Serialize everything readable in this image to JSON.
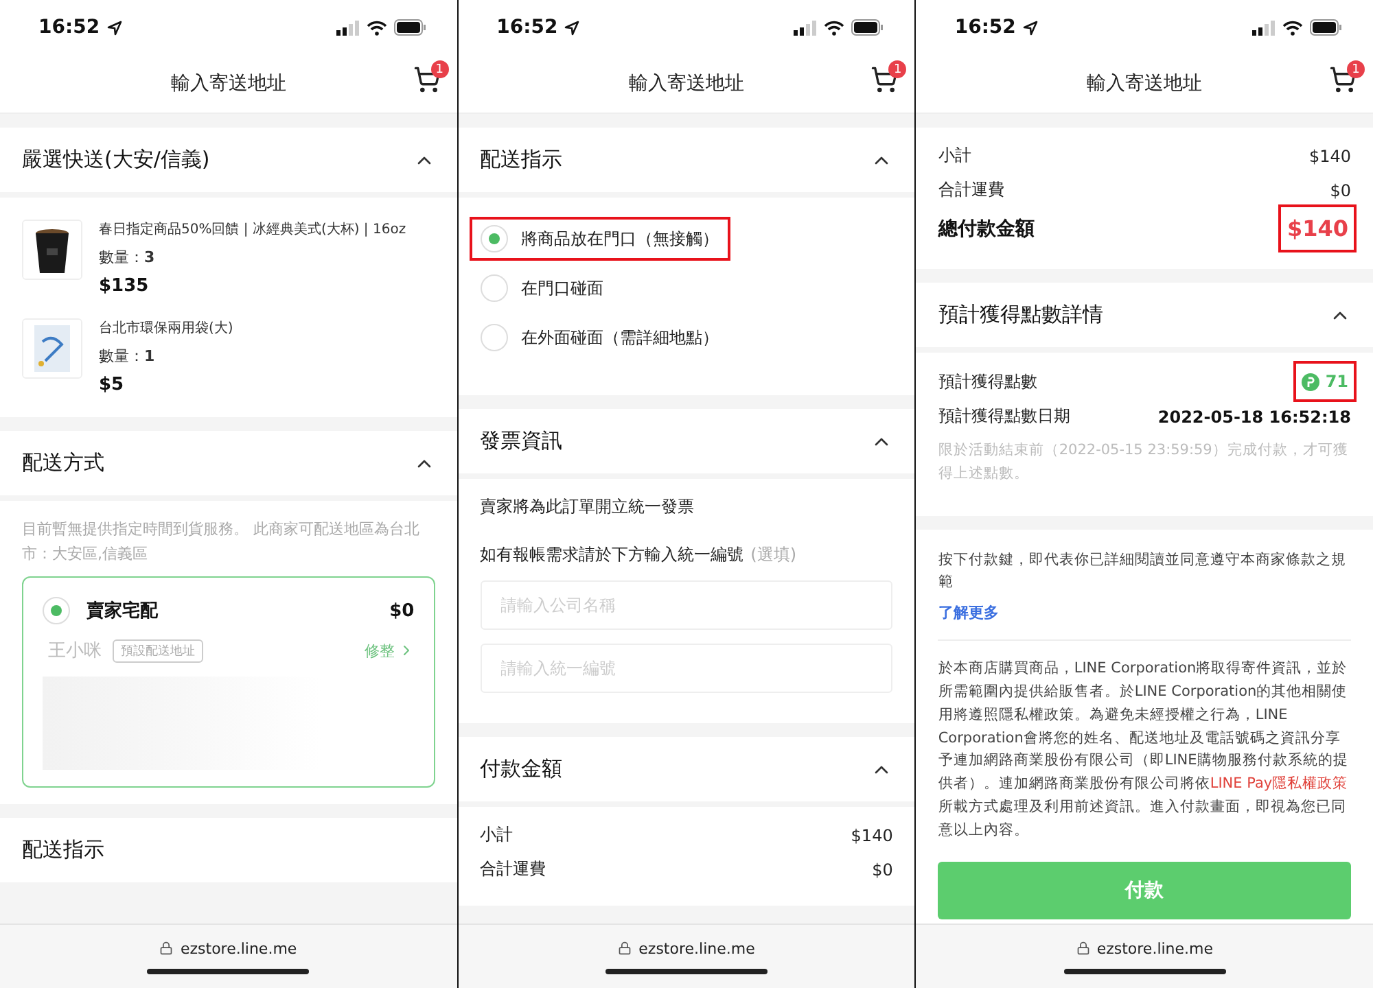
{
  "phones": [
    {
      "time": "16:52",
      "title": "輸入寄送地址",
      "cart_badge": "1",
      "url": "ezstore.line.me",
      "sections": [
        {
          "kind": "products",
          "title": "嚴選快送(大安/信義)",
          "expanded": true,
          "items": [
            {
              "name": "春日指定商品50%回饋 | 冰經典美式(大杯) | 16oz",
              "quantity": "數量：**3**",
              "price": "$135"
            },
            {
              "name": "台北市環保兩用袋(大)",
              "quantity": "數量：**1**",
              "price": "$5"
            }
          ]
        },
        {
          "kind": "shipping",
          "title": "配送方式",
          "expanded": true,
          "note": "目前暫無提供指定時間到貨服務。 此商家可配送地區為台北市：大安區,信義區",
          "option": {
            "label": "賣家宅配",
            "price": "$0",
            "selected": true
          },
          "recipient": "王小咪",
          "tag": "預設配送地址",
          "edit": "修整"
        },
        {
          "kind": "heading",
          "title": "配送指示"
        }
      ]
    },
    {
      "time": "16:52",
      "title": "輸入寄送地址",
      "cart_badge": "1",
      "url": "ezstore.line.me",
      "sections": [
        {
          "kind": "options",
          "title": "配送指示",
          "expanded": true,
          "options": [
            {
              "label": "將商品放在門口（無接觸）",
              "selected": true,
              "highlighted": true
            },
            {
              "label": "在門口碰面",
              "selected": false,
              "highlighted": false
            },
            {
              "label": "在外面碰面（需詳細地點）",
              "selected": false,
              "highlighted": false
            }
          ]
        },
        {
          "kind": "invoice",
          "title": "發票資訊",
          "expanded": true,
          "text": "賣家將為此訂單開立統一發票",
          "prompt": "如有報帳需求請於下方輸入統一編號",
          "optional": "(選填)",
          "fields": [
            {
              "placeholder": "請輸入公司名稱"
            },
            {
              "placeholder": "請輸入統一編號"
            }
          ]
        },
        {
          "kind": "amounts",
          "title": "付款金額",
          "expanded": true,
          "rows": [
            {
              "label": "小計",
              "value": "$140"
            },
            {
              "label": "合計運費",
              "value": "$0"
            }
          ]
        }
      ]
    },
    {
      "time": "16:52",
      "title": "輸入寄送地址",
      "cart_badge": "1",
      "url": "ezstore.line.me",
      "sections": [
        {
          "kind": "amounts",
          "rows": [
            {
              "label": "小計",
              "value": "$140"
            },
            {
              "label": "合計運費",
              "value": "$0"
            }
          ],
          "total": {
            "label": "總付款金額",
            "value": "$140",
            "highlighted": true
          }
        },
        {
          "kind": "points",
          "title": "預計獲得點數詳情",
          "expanded": true,
          "points": {
            "label": "預計獲得點數",
            "value": "71",
            "highlighted": true
          },
          "date": {
            "label": "預計獲得點數日期",
            "value": "2022-05-18 16:52:18"
          },
          "note": "限於活動結束前（2022-05-15 23:59:59）完成付款，才可獲得上述點數。"
        },
        {
          "kind": "terms",
          "agreement": "按下付款鍵，即代表你已詳細閱讀並同意遵守本商家條款之規範",
          "link": "了解更多",
          "privacy_before": "於本商店購買商品，LINE Corporation將取得寄件資訊，並於所需範圍內提供給販售者。於LINE Corporation的其他相關使用將遵照隱私權政策。為避免未經授權之行為，LINE Corporation會將您的姓名、配送地址及電話號碼之資訊分享予連加網路商業股份有限公司（即LINE購物服務付款系統的提供者）。連加網路商業股份有限公司將依",
          "privacy_link": "LINE Pay隱私權政策",
          "privacy_after": "所載方式處理及利用前述資訊。進入付款畫面，即視為您已同意以上內容。",
          "button": "付款"
        }
      ]
    }
  ]
}
